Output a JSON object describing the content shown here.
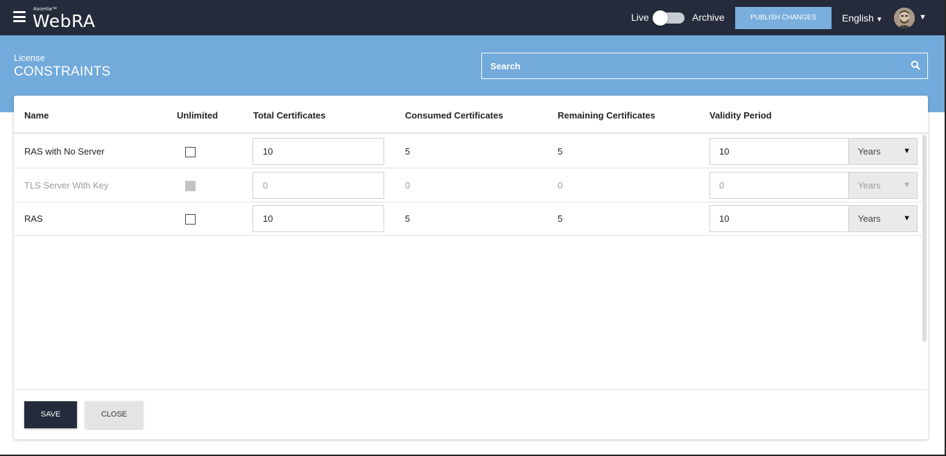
{
  "header": {
    "brand_small": "Ascertia™",
    "brand": "WebRA",
    "live_label": "Live",
    "archive_label": "Archive",
    "publish_label": "PUBLISH CHANGES",
    "language": "English"
  },
  "page": {
    "section_label": "License",
    "title": "CONSTRAINTS",
    "search_placeholder": "Search"
  },
  "table": {
    "columns": [
      "Name",
      "Unlimited",
      "Total Certificates",
      "Consumed Certificates",
      "Remaining Certificates",
      "Validity Period"
    ],
    "rows": [
      {
        "name": "RAS with No Server",
        "unlimited": false,
        "total": "10",
        "consumed": "5",
        "remaining": "5",
        "validity": "10",
        "unit": "Years",
        "disabled": false
      },
      {
        "name": "TLS Server With Key",
        "unlimited": false,
        "total": "0",
        "consumed": "0",
        "remaining": "0",
        "validity": "0",
        "unit": "Years",
        "disabled": true
      },
      {
        "name": "RAS",
        "unlimited": false,
        "total": "10",
        "consumed": "5",
        "remaining": "5",
        "validity": "10",
        "unit": "Years",
        "disabled": false
      }
    ]
  },
  "footer": {
    "save_label": "SAVE",
    "close_label": "CLOSE"
  },
  "colors": {
    "topbar": "#252b3b",
    "band": "#72aadb",
    "publish": "#7aaedd"
  }
}
